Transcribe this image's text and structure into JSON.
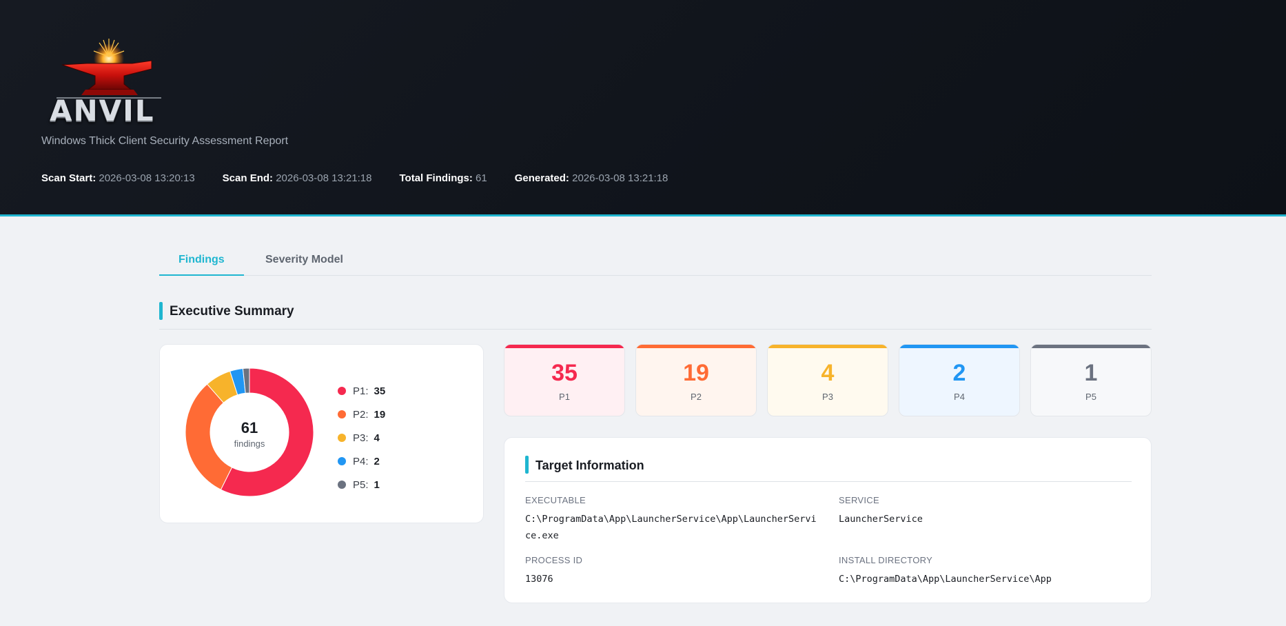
{
  "header": {
    "logo_text": "ANVIL",
    "subtitle": "Windows Thick Client Security Assessment Report",
    "meta": [
      {
        "key": "Scan Start:",
        "value": "2026-03-08 13:20:13"
      },
      {
        "key": "Scan End:",
        "value": "2026-03-08 13:21:18"
      },
      {
        "key": "Total Findings:",
        "value": "61"
      },
      {
        "key": "Generated:",
        "value": "2026-03-08 13:21:18"
      }
    ]
  },
  "tabs": [
    {
      "label": "Findings",
      "active": true
    },
    {
      "label": "Severity Model",
      "active": false
    }
  ],
  "summary": {
    "title": "Executive Summary",
    "total": "61",
    "total_label": "findings"
  },
  "chart_data": {
    "type": "pie",
    "variant": "donut",
    "center_value": "61",
    "center_label": "findings",
    "categories": [
      "P1",
      "P2",
      "P3",
      "P4",
      "P5"
    ],
    "values": [
      35,
      19,
      4,
      2,
      1
    ],
    "colors": [
      "#f5294f",
      "#ff6b35",
      "#f7b32b",
      "#2196f3",
      "#6b7280"
    ],
    "legend_position": "right"
  },
  "legend": [
    {
      "label": "P1:",
      "count": "35"
    },
    {
      "label": "P2:",
      "count": "19"
    },
    {
      "label": "P3:",
      "count": "4"
    },
    {
      "label": "P4:",
      "count": "2"
    },
    {
      "label": "P5:",
      "count": "1"
    }
  ],
  "severity_cards": [
    {
      "count": "35",
      "label": "P1",
      "color": "#f5294f",
      "bg": "#fff0f3"
    },
    {
      "count": "19",
      "label": "P2",
      "color": "#ff6b35",
      "bg": "#fff5ef"
    },
    {
      "count": "4",
      "label": "P3",
      "color": "#f7b32b",
      "bg": "#fffaef"
    },
    {
      "count": "2",
      "label": "P4",
      "color": "#2196f3",
      "bg": "#eef6ff"
    },
    {
      "count": "1",
      "label": "P5",
      "color": "#6b7280",
      "bg": "#f7f8fa"
    }
  ],
  "target": {
    "title": "Target Information",
    "fields": [
      {
        "key": "EXECUTABLE",
        "value": "C:\\ProgramData\\App\\LauncherService\\App\\LauncherService.exe"
      },
      {
        "key": "SERVICE",
        "value": "LauncherService"
      },
      {
        "key": "PROCESS ID",
        "value": "13076"
      },
      {
        "key": "INSTALL DIRECTORY",
        "value": "C:\\ProgramData\\App\\LauncherService\\App"
      }
    ]
  },
  "colors": {
    "accent": "#1fb6d0",
    "header_bg": "#10141b",
    "page_bg": "#f0f2f5"
  }
}
